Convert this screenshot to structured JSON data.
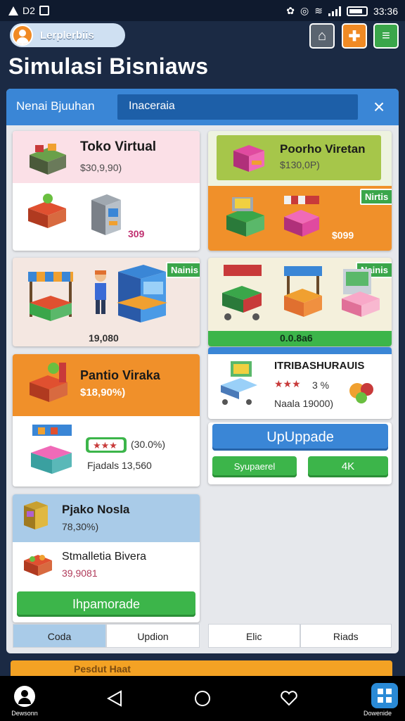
{
  "status_bar": {
    "left_text": "D2",
    "time": "33:36"
  },
  "header": {
    "profile_name": "Lerplerbiis",
    "title": "Simulasi Bisniaws",
    "buttons": [
      "home-icon",
      "gift-icon",
      "stats-icon"
    ]
  },
  "search": {
    "label": "Nenai Bjuuhan",
    "value": "Inaceraia",
    "close": "×"
  },
  "cards": {
    "toko_virtual": {
      "title": "Toko Virtual",
      "price": "$30,9,90)",
      "sub_price": "309"
    },
    "portho_viretan": {
      "title": "Poorho Viretan",
      "price": "$130,0P)",
      "tag": "Nirtis",
      "sub_price": "$099"
    },
    "kiosk_left": {
      "tag": "Nainis",
      "price": "19,080"
    },
    "kiosk_right": {
      "tag": "Nainis",
      "price": "0.0.8a6"
    },
    "pantio_viraka": {
      "title": "Pantio Viraka",
      "price": "$18,90%)",
      "rating_tag": "(30.0%)",
      "sub": "Fjadals 13,560"
    },
    "itrisarjurauis": {
      "title": "ITRIBASHURAUIS",
      "rating": "3 %",
      "sub": "Naala 19000)",
      "upgrade_label": "UpUppade",
      "sub_button": "Syupaerel",
      "count_button": "4K"
    },
    "pjako_nosia": {
      "title": "Pjako Nosla",
      "price": "78,30%)",
      "item_title": "Stmalletia Bivera",
      "item_price": "39,9081",
      "upgrade_label": "Ihpamorade"
    }
  },
  "tabs_left": [
    "Coda",
    "Updion"
  ],
  "tabs_right": [
    "Elic",
    "Riads"
  ],
  "bottom_strip": "Pesdut Haat",
  "navbar": {
    "left_caption": "Dewsonn",
    "right_caption": "Dowenide"
  },
  "colors": {
    "accent": "#3a86d6",
    "green": "#3cb54a",
    "orange": "#f0902a",
    "pink": "#fbe3ea",
    "lime": "#a6c64a"
  }
}
